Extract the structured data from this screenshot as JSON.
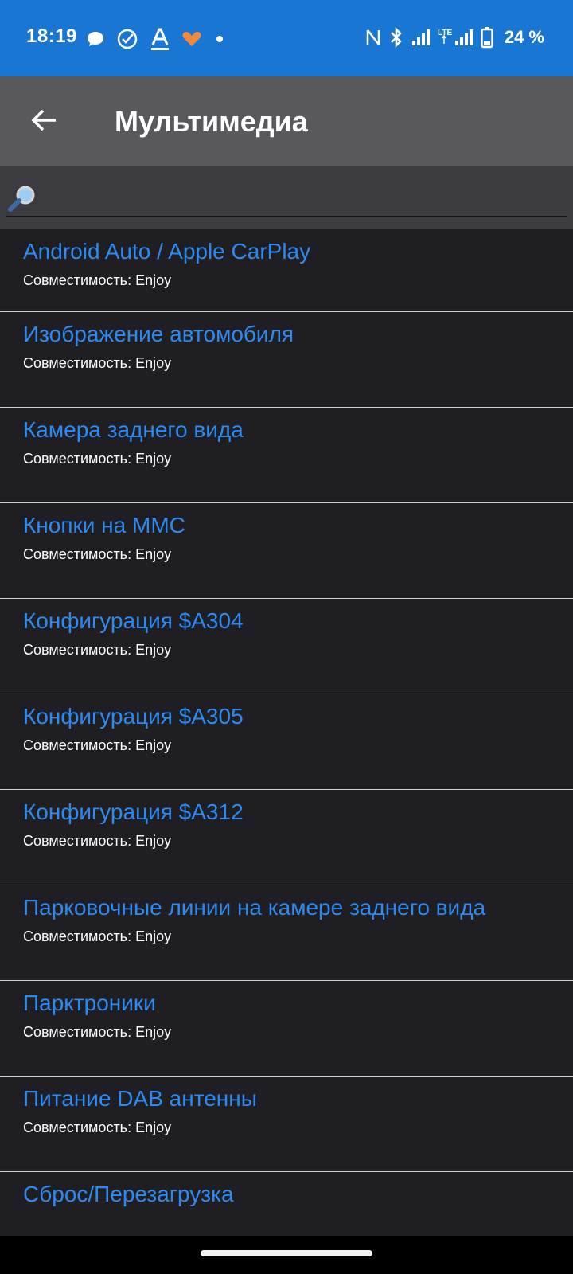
{
  "status_bar": {
    "time": "18:19",
    "battery_percent": "24 %",
    "icons_left": [
      "message-icon",
      "check-circle-icon",
      "text-a-icon",
      "heart-app-icon",
      "dot-icon"
    ],
    "icons_right": [
      "nfc-icon",
      "bluetooth-icon",
      "signal-icon",
      "lte-signal-icon",
      "battery-icon"
    ]
  },
  "app_bar": {
    "title": "Мультимедиа",
    "back_icon": "arrow-left-icon"
  },
  "search": {
    "placeholder": "",
    "value": "",
    "icon": "magnifier-icon"
  },
  "list": {
    "items": [
      {
        "title": "Android Auto / Apple CarPlay",
        "subtitle": "Совместимость: Enjoy"
      },
      {
        "title": "Изображение автомобиля",
        "subtitle": "Совместимость: Enjoy"
      },
      {
        "title": "Камера заднего вида",
        "subtitle": "Совместимость: Enjoy"
      },
      {
        "title": "Кнопки на ММС",
        "subtitle": "Совместимость: Enjoy"
      },
      {
        "title": "Конфигурация $A304",
        "subtitle": "Совместимость: Enjoy"
      },
      {
        "title": "Конфигурация $A305",
        "subtitle": "Совместимость: Enjoy"
      },
      {
        "title": "Конфигурация $A312",
        "subtitle": "Совместимость: Enjoy"
      },
      {
        "title": "Парковочные линии на камере заднего вида",
        "subtitle": "Совместимость: Enjoy"
      },
      {
        "title": "Парктроники",
        "subtitle": "Совместимость: Enjoy"
      },
      {
        "title": "Питание DAB антенны",
        "subtitle": "Совместимость: Enjoy"
      },
      {
        "title": "Сброс/Перезагрузка",
        "subtitle": ""
      }
    ]
  },
  "colors": {
    "status_bar_bg": "#1976d2",
    "app_bar_bg": "#59585c",
    "list_bg": "#1f1e22",
    "title_link": "#2d8af0"
  }
}
